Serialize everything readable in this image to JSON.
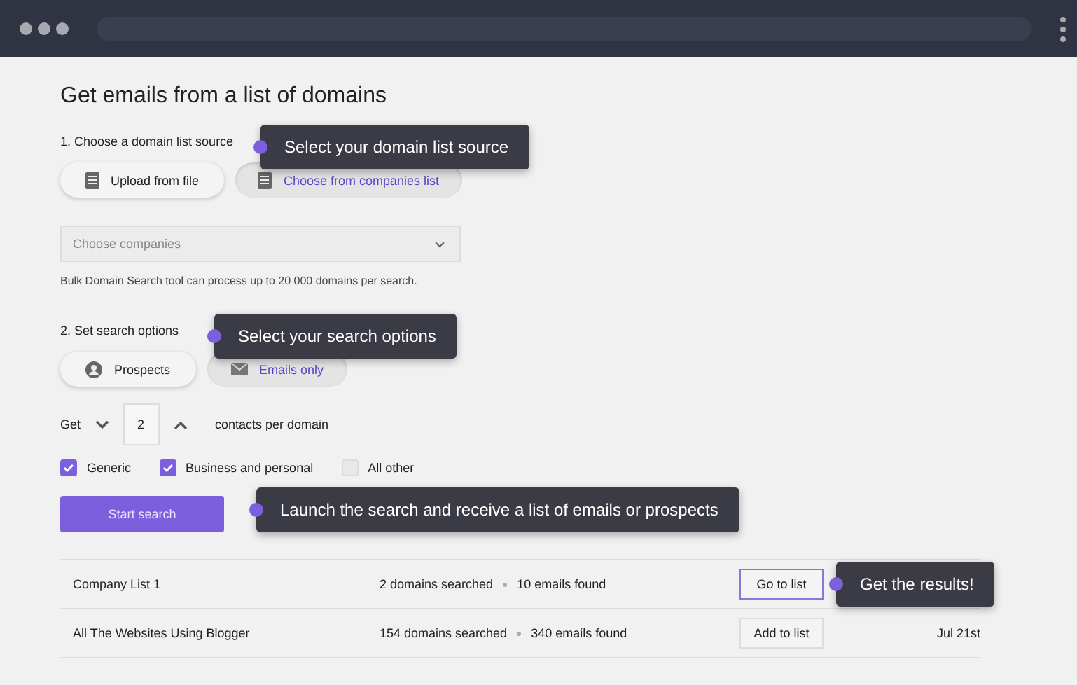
{
  "title": "Get emails from a list of domains",
  "step1": {
    "label": "1. Choose a domain list source",
    "sources": [
      {
        "label": "Upload from file",
        "selected": false
      },
      {
        "label": "Choose from companies list",
        "selected": true
      }
    ],
    "dropdown": {
      "placeholder": "Choose companies"
    },
    "note": "Bulk Domain Search tool can process up to 20 000 domains per search."
  },
  "step2": {
    "label": "2. Set search options",
    "modes": [
      {
        "label": "Prospects",
        "kind": "person",
        "selected": false
      },
      {
        "label": "Emails only",
        "kind": "mail",
        "selected": true
      }
    ],
    "get_label": "Get",
    "count": "2",
    "count_suffix": "contacts per domain",
    "filters": [
      {
        "label": "Generic",
        "checked": true
      },
      {
        "label": "Business and personal",
        "checked": true
      },
      {
        "label": "All other",
        "checked": false
      }
    ]
  },
  "start_button": "Start search",
  "results": [
    {
      "name": "Company List 1",
      "domains": "2 domains searched",
      "emails": "10 emails found",
      "action": "Go to list",
      "highlighted": true
    },
    {
      "name": "All The Websites Using Blogger",
      "domains": "154 domains searched",
      "emails": "340 emails found",
      "action": "Add to list",
      "highlighted": false,
      "date": "Jul 21st"
    }
  ],
  "tooltips": [
    {
      "text": "Select your domain list source"
    },
    {
      "text": "Select your search options"
    },
    {
      "text": "Launch the search and receive a list of emails or prospects"
    },
    {
      "text": "Get the results!"
    }
  ]
}
